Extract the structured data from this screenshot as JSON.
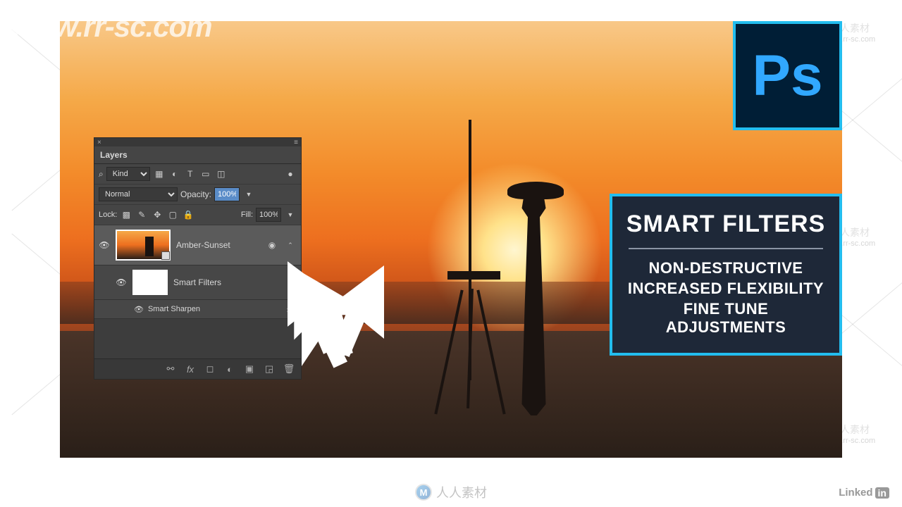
{
  "main_watermark": "www.rr-sc.com",
  "wm_cn": "人人素材",
  "wm_url": "www.rr-sc.com",
  "panel": {
    "title": "Layers",
    "kind_label": "Kind",
    "blend_mode": "Normal",
    "opacity_label": "Opacity:",
    "opacity_value": "100%",
    "lock_label": "Lock:",
    "fill_label": "Fill:",
    "fill_value": "100%",
    "layer_name": "Amber-Sunset",
    "smart_filters_label": "Smart Filters",
    "filter_items": [
      "Smart Sharpen"
    ]
  },
  "ps_logo": "Ps",
  "info": {
    "title": "SMART FILTERS",
    "lines": [
      "NON-DESTRUCTIVE",
      "INCREASED FLEXIBILITY",
      "FINE TUNE ADJUSTMENTS"
    ]
  },
  "linkedin_label": "Linked",
  "linkedin_in": "in",
  "bottom_brand": "人人素材"
}
